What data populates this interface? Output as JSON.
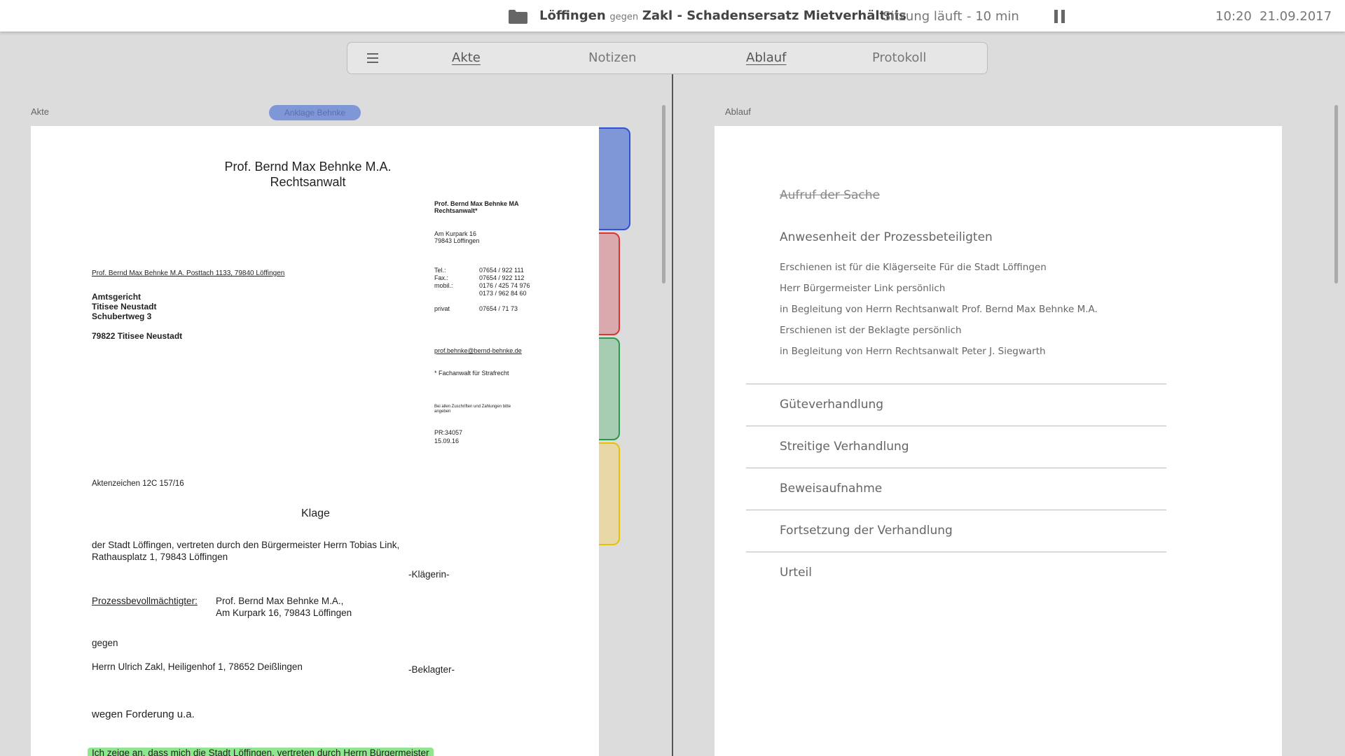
{
  "topbar": {
    "party_plaintiff": "Löffingen",
    "versus": "gegen",
    "case_rest": "Zakl - Schadensersatz Mietverhältnis",
    "session_status": "Sitzung läuft",
    "session_time": "- 10 min",
    "clock": "10:20",
    "date": "21.09.2017"
  },
  "nav": {
    "tabs": [
      {
        "label": "Akte",
        "active": true
      },
      {
        "label": "Notizen",
        "active": false
      },
      {
        "label": "Ablauf",
        "active": true
      },
      {
        "label": "Protokoll",
        "active": false
      }
    ]
  },
  "left_panel": {
    "label": "Akte",
    "doc_tag": "Anklage Behnke",
    "tab_colors": [
      "#7f97d6",
      "#d9a9ad",
      "#a6cdb1",
      "#e8d8a6"
    ]
  },
  "document": {
    "letterhead_name": "Prof. Bernd Max Behnke M.A.",
    "letterhead_title": "Rechtsanwalt",
    "side_name": "Prof. Bernd Max Behnke MA",
    "side_title": "Rechtsanwalt*",
    "side_street": "Am Kurpark 16",
    "side_city": "79843 Löffingen",
    "return_address": "Prof. Bernd Max Behnke M.A. Posttach 1133, 79840 Löffingen",
    "recipient_1": "Amtsgericht",
    "recipient_2": "Titisee Neustadt",
    "recipient_3": "Schubertweg 3",
    "recipient_4": "79822 Titisee Neustadt",
    "contacts": [
      {
        "label": "Tel.:",
        "value": "07654 / 922 111"
      },
      {
        "label": "Fax.:",
        "value": "07654 / 922 112"
      },
      {
        "label": "mobil.:",
        "value": "0176 / 425 74 976"
      },
      {
        "label": "",
        "value": "0173 / 962 84 60"
      },
      {
        "label": "privat",
        "value": "07654 / 71 73"
      }
    ],
    "email": "prof.behnke@bernd-behnke.de",
    "specialty": "* Fachanwalt für Strafrecht",
    "note_1": "Bei allen Zuschriften und Zahlungen bitte",
    "note_2": "angeben",
    "ref_1": "PR:34057",
    "ref_2": "15.09.16",
    "case_number": "Aktenzeichen 12C 157/16",
    "doc_title": "Klage",
    "plaintiff_1": "der Stadt Löffingen, vertreten durch den Bürgermeister Herrn Tobias Link,",
    "plaintiff_2": "Rathausplatz 1, 79843 Löffingen",
    "plaintiff_role": "-Klägerin-",
    "counsel_label": "Prozessbevollmächtigter:",
    "counsel_1": "Prof. Bernd Max Behnke M.A.,",
    "counsel_2": "Am Kurpark 16, 79843 Löffingen",
    "against": "gegen",
    "defendant": "Herrn Ulrich Zakl, Heiligenhof 1, 78652 Deißlingen",
    "defendant_role": "-Beklagter-",
    "subject": "wegen Forderung u.a.",
    "highlighted": "Ich zeige an, dass mich die Stadt Löffingen, vertreten durch Herrn Bürgermeister",
    "highlight_color": "#8ee68e"
  },
  "right_panel": {
    "label": "Ablauf",
    "done_item": "Aufruf der Sache",
    "attendance_heading": "Anwesenheit der Prozessbeteiligten",
    "attendance_lines": [
      "Erschienen ist für die Klägerseite Für die Stadt Löffingen",
      "Herr Bürgermeister Link persönlich",
      "in Begleitung von Herrn Rechtsanwalt Prof. Bernd Max Behnke M.A.",
      "Erschienen ist der Beklagte persönlich",
      "in Begleitung von Herrn Rechtsanwalt Peter J. Siegwarth"
    ],
    "sections": [
      "Güteverhandlung",
      "Streitige Verhandlung",
      "Beweisaufnahme",
      "Fortsetzung der Verhandlung",
      "Urteil"
    ]
  }
}
